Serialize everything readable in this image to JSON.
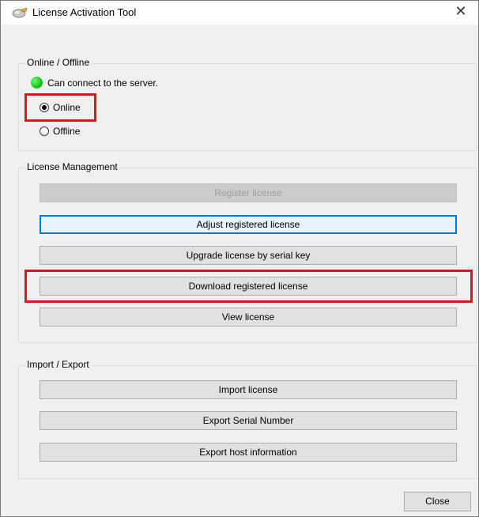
{
  "window": {
    "title": "License Activation Tool",
    "close_glyph": "✕",
    "icon": "key-icon"
  },
  "online_offline": {
    "group_label": "Online / Offline",
    "status_text": "Can connect to the server.",
    "status_color": "#16c316",
    "options": [
      {
        "label": "Online",
        "selected": true
      },
      {
        "label": "Offline",
        "selected": false
      }
    ]
  },
  "license_management": {
    "group_label": "License Management",
    "buttons": [
      {
        "label": "Register license",
        "enabled": false
      },
      {
        "label": "Adjust registered license",
        "enabled": true,
        "focused": true
      },
      {
        "label": "Upgrade license by serial key",
        "enabled": true
      },
      {
        "label": "Download registered license",
        "enabled": true,
        "highlighted": true
      },
      {
        "label": "View license",
        "enabled": true
      }
    ]
  },
  "import_export": {
    "group_label": "Import / Export",
    "buttons": [
      {
        "label": "Import license"
      },
      {
        "label": "Export Serial Number"
      },
      {
        "label": "Export host information"
      }
    ]
  },
  "footer": {
    "close_label": "Close"
  },
  "colors": {
    "highlight_red": "#e0141e",
    "focus_blue": "#0078d7"
  }
}
